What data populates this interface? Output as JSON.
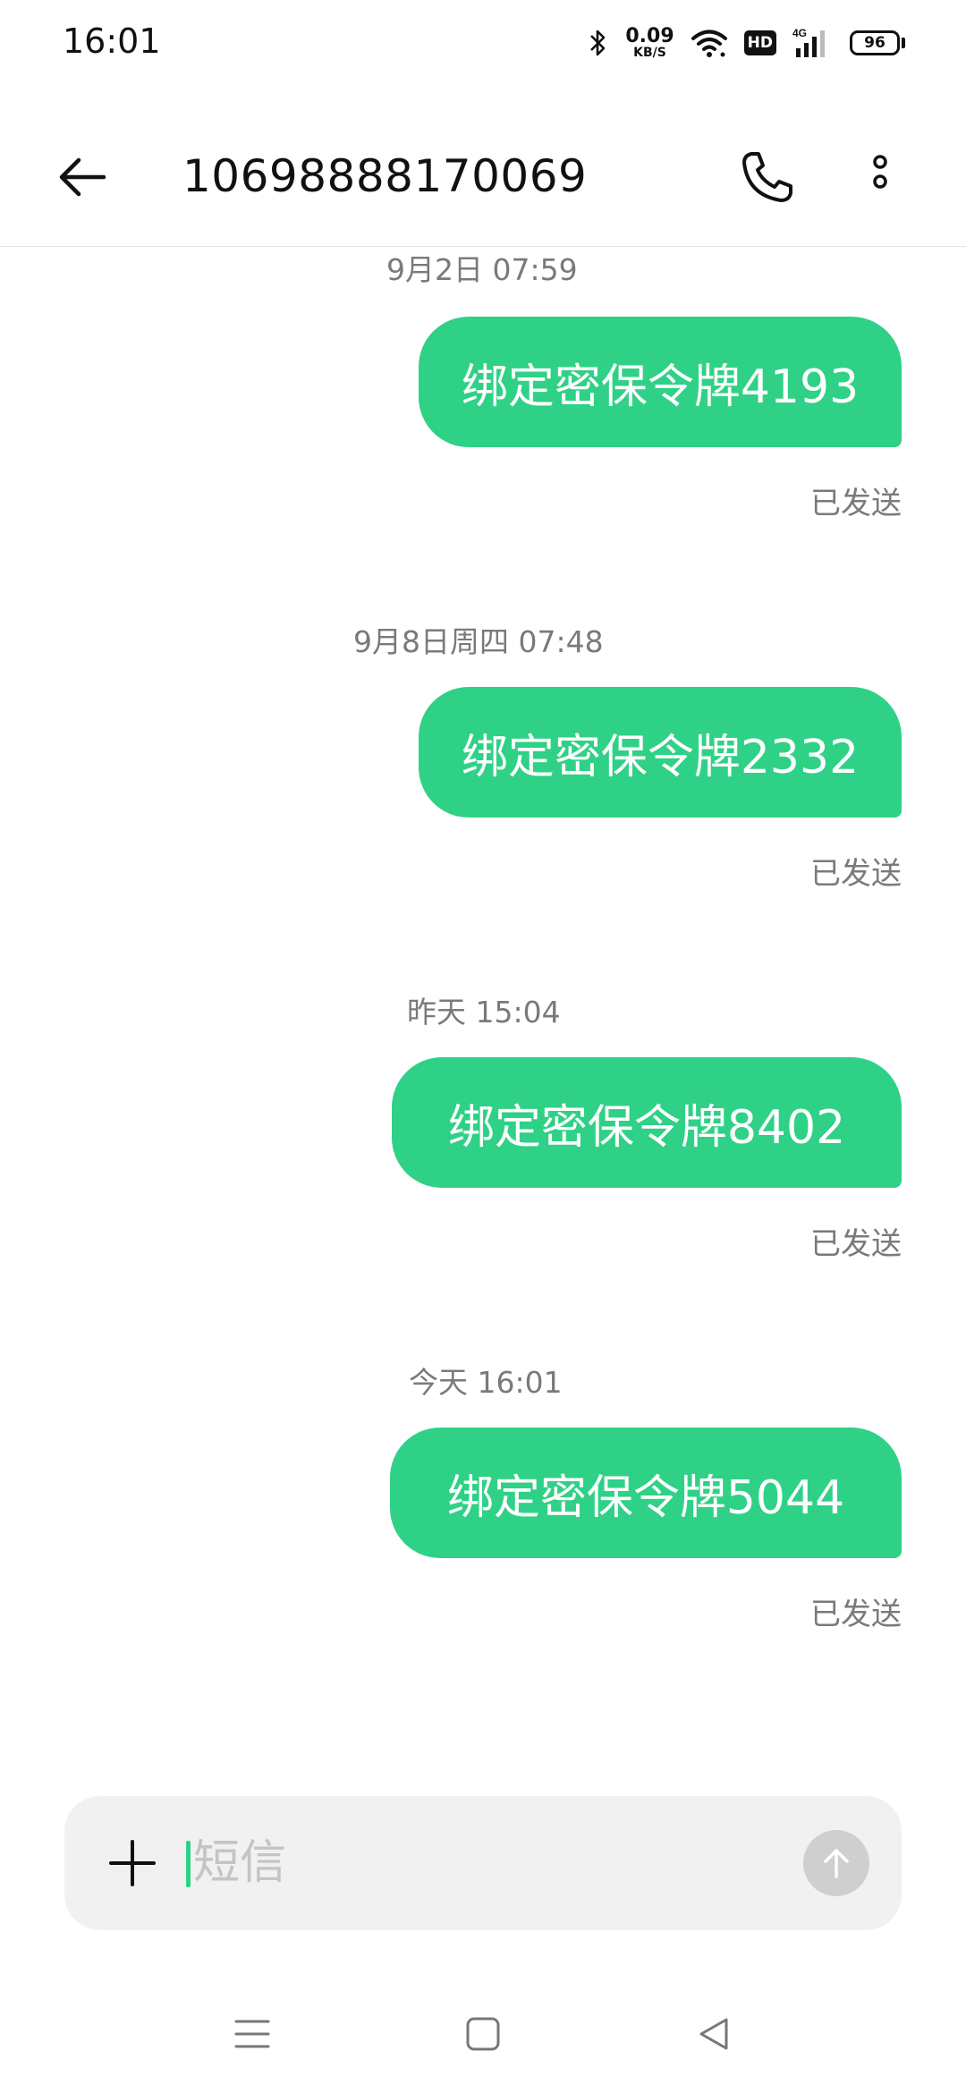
{
  "status_bar": {
    "time": "16:01",
    "net_speed_value": "0.09",
    "net_speed_unit": "KB/S",
    "hd_label": "HD",
    "network_label": "4G",
    "battery_level": "96",
    "icons": [
      "bluetooth-icon",
      "wifi-icon",
      "signal-icon",
      "battery-icon"
    ]
  },
  "header": {
    "title": "10698888170069",
    "icons": [
      "back-arrow-icon",
      "phone-icon",
      "more-vertical-icon"
    ]
  },
  "messages": [
    {
      "timestamp": "9月2日 07:59",
      "text": "绑定密保令牌4193",
      "status": "已发送"
    },
    {
      "timestamp": "9月8日周四 07:48",
      "text": "绑定密保令牌2332",
      "status": "已发送"
    },
    {
      "timestamp": "昨天 15:04",
      "text": "绑定密保令牌8402",
      "status": "已发送"
    },
    {
      "timestamp": "今天 16:01",
      "text": "绑定密保令牌5044",
      "status": "已发送"
    }
  ],
  "composer": {
    "placeholder": "短信",
    "value": "",
    "icons": [
      "plus-icon",
      "send-arrow-up-icon"
    ]
  },
  "nav_bar": {
    "icons": [
      "menu-icon",
      "home-square-icon",
      "back-triangle-icon"
    ]
  },
  "colors": {
    "bubble": "#2fd186",
    "secondary_text": "#7a7a7a",
    "input_background": "#f1f1f1",
    "send_button": "#cfcfcf"
  }
}
